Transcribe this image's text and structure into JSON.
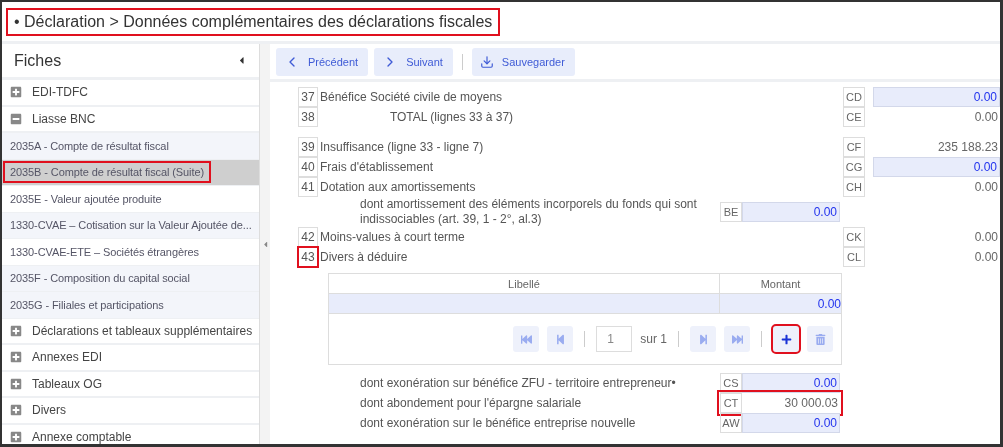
{
  "title": {
    "text": "• Déclaration > Données complémentaires des déclarations fiscales",
    "highlighted": true
  },
  "sidebar": {
    "title": "Fiches",
    "groups": [
      {
        "label": "EDI-TDFC",
        "expanded": false
      },
      {
        "label": "Liasse BNC",
        "expanded": true,
        "children": [
          {
            "label": "2035A - Compte de résultat fiscal",
            "selected": false,
            "highlighted": false
          },
          {
            "label": "2035B - Compte de résultat fiscal (Suite)",
            "selected": true,
            "highlighted": true
          },
          {
            "label": "2035E - Valeur ajoutée produite",
            "selected": false,
            "highlighted": false
          },
          {
            "label": "1330-CVAE – Cotisation sur la Valeur Ajoutée de...",
            "selected": false,
            "highlighted": false
          },
          {
            "label": "1330-CVAE-ETE – Sociétés étrangères",
            "selected": false,
            "highlighted": false
          },
          {
            "label": "2035F - Composition du capital social",
            "selected": false,
            "highlighted": false
          },
          {
            "label": "2035G - Filiales et participations",
            "selected": false,
            "highlighted": false
          }
        ]
      },
      {
        "label": "Déclarations et tableaux supplémentaires",
        "expanded": false
      },
      {
        "label": "Annexes EDI",
        "expanded": false
      },
      {
        "label": "Tableaux OG",
        "expanded": false
      },
      {
        "label": "Divers",
        "expanded": false
      },
      {
        "label": "Annexe comptable",
        "expanded": false
      }
    ]
  },
  "toolbar": [
    {
      "kind": "previous",
      "label": "Précédent"
    },
    {
      "kind": "next",
      "label": "Suivant"
    },
    {
      "kind": "save",
      "label": "Sauvegarder"
    }
  ],
  "form": {
    "sections": [
      {
        "rows": [
          {
            "kind": "line",
            "number": "37",
            "label": "Bénéfice Société civile de moyens",
            "code": "CD",
            "value": "0.00",
            "editable": true,
            "highlighted": false
          },
          {
            "kind": "total",
            "number": "38",
            "label": "TOTAL (lignes 33 à 37)",
            "code": "CE",
            "value": "0.00",
            "editable": false,
            "highlighted": false
          }
        ]
      },
      {
        "rows": [
          {
            "kind": "line",
            "number": "39",
            "label": "Insuffisance (ligne 33 - ligne 7)",
            "code": "CF",
            "value": "235 188.23",
            "editable": false,
            "highlighted": false
          },
          {
            "kind": "line",
            "number": "40",
            "label": "Frais d'établissement",
            "code": "CG",
            "value": "0.00",
            "editable": true,
            "highlighted": false
          },
          {
            "kind": "line",
            "number": "41",
            "label": "Dotation aux amortissements",
            "code": "CH",
            "value": "0.00",
            "editable": false,
            "highlighted": false
          },
          {
            "kind": "sub",
            "label": "dont amortissement des éléments incorporels du fonds qui sont indissociables (art. 39, 1 - 2°, al.3)",
            "code": "BE",
            "value": "0.00",
            "editable": true,
            "highlighted": false
          },
          {
            "kind": "line",
            "number": "42",
            "label": "Moins-values à court terme",
            "code": "CK",
            "value": "0.00",
            "editable": false,
            "highlighted": false
          },
          {
            "kind": "line",
            "number": "43",
            "label": "Divers à déduire",
            "code": "CL",
            "value": "0.00",
            "editable": false,
            "highlighted": true
          },
          {
            "kind": "table",
            "columns": [
              "Libellé",
              "Montant"
            ],
            "rows": [
              {
                "montant": "0.00"
              }
            ],
            "pager": {
              "page": "1",
              "total": "sur 1",
              "add_highlighted": true
            }
          },
          {
            "kind": "sub",
            "label": "dont exonération sur bénéfice ZFU - territoire entrepreneur•",
            "code": "CS",
            "value": "0.00",
            "editable": true,
            "highlighted": false
          },
          {
            "kind": "sub",
            "label": "dont abondement pour l'épargne salariale",
            "code": "CT",
            "value": "30 000.03",
            "editable": false,
            "highlighted": true
          },
          {
            "kind": "sub",
            "label": "dont exonération sur le bénéfice entreprise nouvelle",
            "code": "AW",
            "value": "0.00",
            "editable": true,
            "highlighted": false
          }
        ]
      }
    ]
  }
}
